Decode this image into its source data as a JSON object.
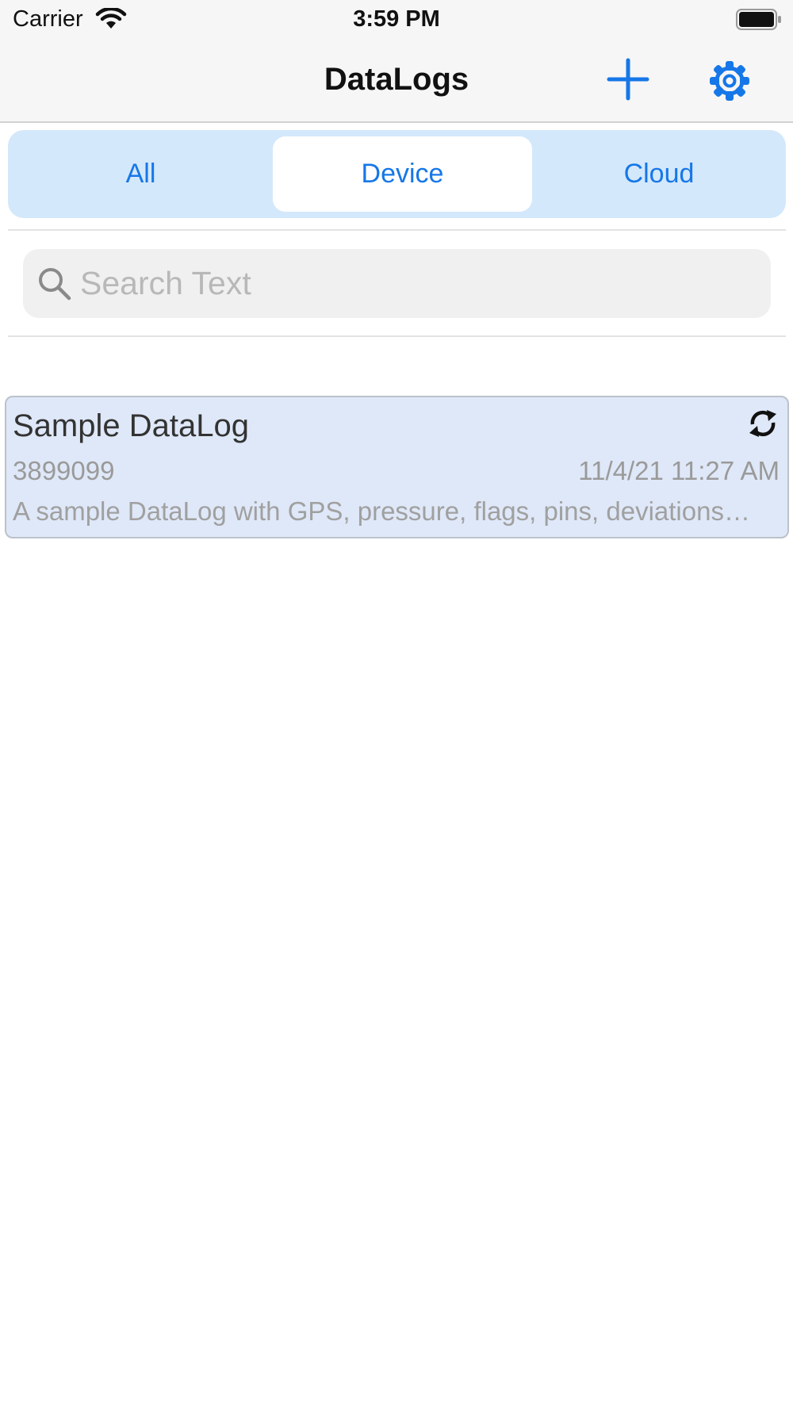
{
  "status_bar": {
    "carrier": "Carrier",
    "time": "3:59 PM"
  },
  "nav": {
    "title": "DataLogs",
    "add_icon": "plus-icon",
    "settings_icon": "gear-icon"
  },
  "segments": [
    {
      "label": "All",
      "selected": false
    },
    {
      "label": "Device",
      "selected": true
    },
    {
      "label": "Cloud",
      "selected": false
    }
  ],
  "search": {
    "placeholder": "Search Text",
    "value": ""
  },
  "logs": [
    {
      "name": "Sample DataLog",
      "id": "3899099",
      "date": "11/4/21 11:27 AM",
      "description": "A sample DataLog with GPS, pressure, flags, pins, deviations…",
      "status_icon": "sync-icon"
    }
  ],
  "colors": {
    "accent": "#1677e8",
    "segment_bg": "#d4e8fb",
    "card_bg": "#dfe8f8"
  }
}
